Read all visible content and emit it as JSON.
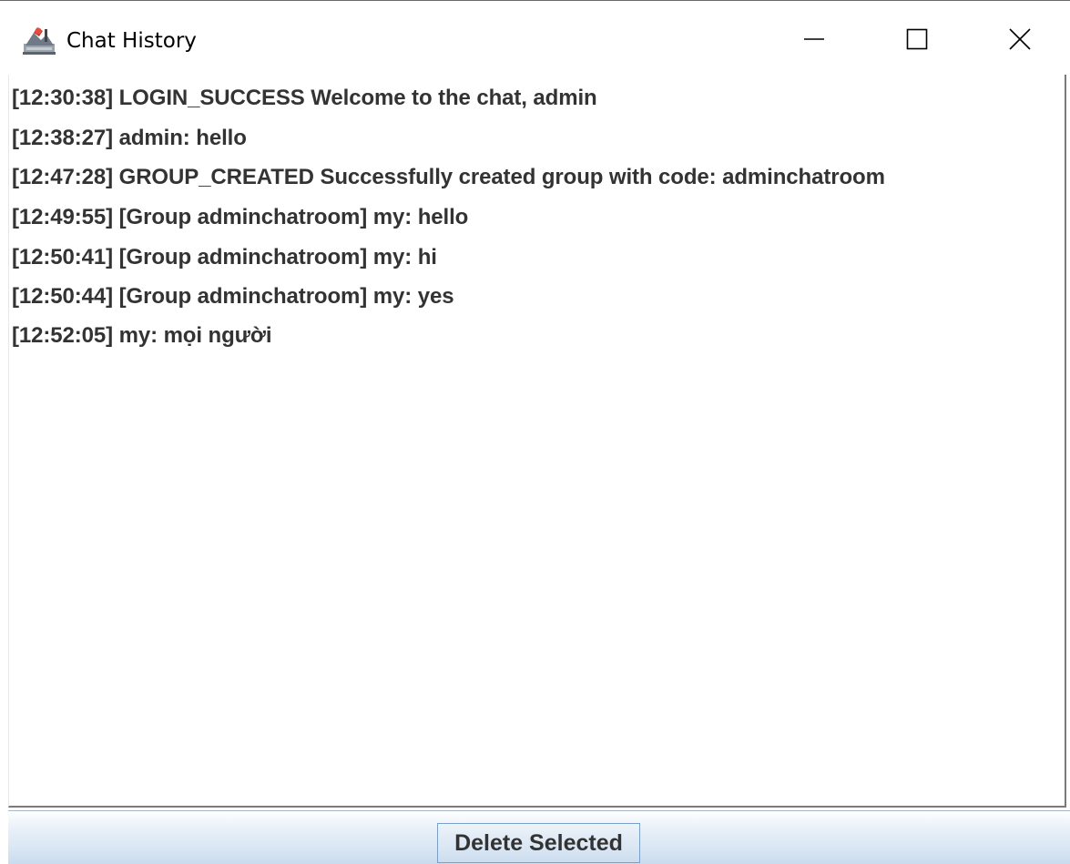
{
  "window": {
    "title": "Chat History",
    "icon": "java-app-icon",
    "controls": {
      "minimize": "minimize-icon",
      "maximize": "maximize-icon",
      "close": "close-icon"
    }
  },
  "history": {
    "items": [
      "[12:30:38] LOGIN_SUCCESS Welcome to the chat, admin",
      "[12:38:27] admin: hello",
      "[12:47:28] GROUP_CREATED Successfully created group with code: adminchatroom",
      "[12:49:55] [Group adminchatroom] my: hello",
      "[12:50:41] [Group adminchatroom] my: hi",
      "[12:50:44] [Group adminchatroom] my: yes",
      "[12:52:05] my: mọi người"
    ]
  },
  "actions": {
    "delete_label": "Delete Selected"
  },
  "colors": {
    "text": "#333333",
    "button_bar_top": "#eaf1f8",
    "button_bar_bottom": "#c9dbee",
    "button_border": "#7aa0c8"
  }
}
